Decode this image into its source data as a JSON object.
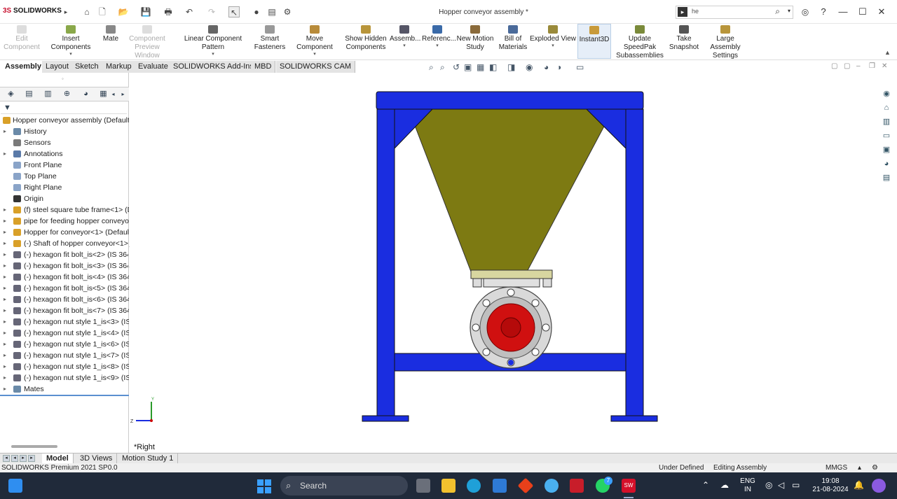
{
  "app": {
    "logo_prefix": "3S",
    "logo_text": "SOLIDWORKS",
    "title": "Hopper conveyor assembly *"
  },
  "quick_access": {
    "icons": [
      "home-icon",
      "new-document-icon",
      "open-icon",
      "save-icon",
      "print-icon",
      "undo-icon",
      "redo-icon",
      "select-icon",
      "traffic-light-icon",
      "file-properties-icon",
      "options-icon"
    ]
  },
  "search": {
    "value": "he"
  },
  "window_controls": {
    "help_icon": "?",
    "minimize": "—",
    "maximize": "☐",
    "close": "✕"
  },
  "ribbon": {
    "buttons": [
      {
        "label": "Edit\nComponent",
        "disabled": true
      },
      {
        "label": "Insert Components",
        "disabled": false
      },
      {
        "label": "Mate",
        "disabled": false
      },
      {
        "label": "Component\nPreview Window",
        "disabled": true
      },
      {
        "label": "Linear Component Pattern",
        "disabled": false
      },
      {
        "label": "Smart\nFasteners",
        "disabled": false
      },
      {
        "label": "Move Component",
        "disabled": false
      },
      {
        "label": "Show Hidden\nComponents",
        "disabled": false
      },
      {
        "label": "Assemb...",
        "disabled": false
      },
      {
        "label": "Referenc...",
        "disabled": false
      },
      {
        "label": "New Motion\nStudy",
        "disabled": false
      },
      {
        "label": "Bill of\nMaterials",
        "disabled": false
      },
      {
        "label": "Exploded View",
        "disabled": false
      },
      {
        "label": "Instant3D",
        "disabled": false,
        "active": true
      },
      {
        "label": "Update SpeedPak\nSubassemblies",
        "disabled": false
      },
      {
        "label": "Take\nSnapshot",
        "disabled": false
      },
      {
        "label": "Large Assembly\nSettings",
        "disabled": false
      }
    ]
  },
  "tabs": [
    "Assembly",
    "Layout",
    "Sketch",
    "Markup",
    "Evaluate",
    "SOLIDWORKS Add-Ins",
    "MBD",
    "SOLIDWORKS CAM"
  ],
  "active_tab": "Assembly",
  "feature_tree": {
    "root": "Hopper conveyor assembly  (Default",
    "items": [
      {
        "label": "History",
        "icon": "history-icon",
        "expand": true
      },
      {
        "label": "Sensors",
        "icon": "sensors-icon",
        "expand": false
      },
      {
        "label": "Annotations",
        "icon": "annotations-icon",
        "expand": true
      },
      {
        "label": "Front Plane",
        "icon": "plane-icon",
        "expand": false
      },
      {
        "label": "Top Plane",
        "icon": "plane-icon",
        "expand": false
      },
      {
        "label": "Right Plane",
        "icon": "plane-icon",
        "expand": false
      },
      {
        "label": "Origin",
        "icon": "origin-icon",
        "expand": false
      },
      {
        "label": "(f) steel square tube frame<1> (D",
        "icon": "part-icon",
        "expand": true
      },
      {
        "label": "pipe for feeding hopper conveyo",
        "icon": "part-icon",
        "expand": true
      },
      {
        "label": "Hopper for conveyor<1> (Defaul",
        "icon": "part-icon",
        "expand": true
      },
      {
        "label": "(-) Shaft of hopper conveyor<1>",
        "icon": "part-icon",
        "expand": true
      },
      {
        "label": "(-) hexagon fit bolt_is<2> (IS 364",
        "icon": "bolt-icon",
        "expand": true
      },
      {
        "label": "(-) hexagon fit bolt_is<3> (IS 364",
        "icon": "bolt-icon",
        "expand": true
      },
      {
        "label": "(-) hexagon fit bolt_is<4> (IS 364",
        "icon": "bolt-icon",
        "expand": true
      },
      {
        "label": "(-) hexagon fit bolt_is<5> (IS 364",
        "icon": "bolt-icon",
        "expand": true
      },
      {
        "label": "(-) hexagon fit bolt_is<6> (IS 364",
        "icon": "bolt-icon",
        "expand": true
      },
      {
        "label": "(-) hexagon fit bolt_is<7> (IS 364",
        "icon": "bolt-icon",
        "expand": true
      },
      {
        "label": "(-) hexagon nut style 1_is<3> (IS 1",
        "icon": "bolt-icon",
        "expand": true
      },
      {
        "label": "(-) hexagon nut style 1_is<4> (IS 1",
        "icon": "bolt-icon",
        "expand": true
      },
      {
        "label": "(-) hexagon nut style 1_is<6> (IS 1",
        "icon": "bolt-icon",
        "expand": true
      },
      {
        "label": "(-) hexagon nut style 1_is<7> (IS 1",
        "icon": "bolt-icon",
        "expand": true
      },
      {
        "label": "(-) hexagon nut style 1_is<8> (IS 1",
        "icon": "bolt-icon",
        "expand": true
      },
      {
        "label": "(-) hexagon nut style 1_is<9> (IS 1",
        "icon": "bolt-icon",
        "expand": true
      },
      {
        "label": "Mates",
        "icon": "mates-icon",
        "expand": true
      }
    ]
  },
  "viewport": {
    "view_label": "*Right",
    "axis_y": "Y",
    "axis_z": "Z",
    "colors": {
      "frame": "#1a2de0",
      "hopper": "#7d7a12",
      "flange": "#d9d9d9",
      "shaft": "#d01010"
    }
  },
  "bottom_tabs": [
    "Model",
    "3D Views",
    "Motion Study 1"
  ],
  "active_bottom_tab": "Model",
  "status": {
    "product": "SOLIDWORKS Premium 2021 SP0.0",
    "state": "Under Defined",
    "mode": "Editing Assembly",
    "units": "MMGS"
  },
  "taskbar": {
    "search": "Search",
    "lang_1": "ENG",
    "lang_2": "IN",
    "time": "19:08",
    "date": "21-08-2024",
    "badge": "7"
  }
}
